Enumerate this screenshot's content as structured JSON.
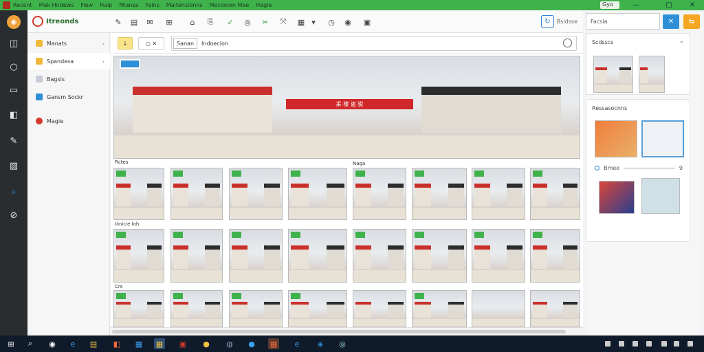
{
  "titlebar": {
    "menu": [
      "Recent",
      "Mak Hndews",
      "Fiew",
      "Halp",
      "Mianes",
      "Fains",
      "Maitensionns",
      "Mecionen Mae",
      "Hagle"
    ],
    "title": "Gyo",
    "controls": [
      "—",
      "□",
      "✕"
    ]
  },
  "app": {
    "brand": "Itreonds"
  },
  "header": {
    "tools": [
      "✎",
      "▤",
      "✉",
      "⊞",
      "⌂",
      "⎘",
      "✓",
      "◎",
      "✂",
      "⤧",
      "▦",
      "▾",
      "◷",
      "◉",
      "▣"
    ],
    "refresh_icon": "↻",
    "right_label": "Bsidsse"
  },
  "right_header": {
    "placeholder": "Facsia",
    "blue_btn": "✕",
    "orange_btn": "⇆"
  },
  "nav": {
    "items": [
      {
        "label": "Manats",
        "color": "#f0b93a",
        "chevron": "›"
      },
      {
        "label": "Spandesa",
        "color": "#f0b93a",
        "chevron": "›"
      },
      {
        "label": "Bagsls",
        "color": "#c5ccd6",
        "chevron": ""
      },
      {
        "label": "Gansm Sockr",
        "color": "#2d8fd5",
        "chevron": ""
      },
      {
        "label": "Magie",
        "color": "#d53a2b",
        "chevron": ""
      }
    ]
  },
  "search": {
    "chip1": "↓",
    "chip2": "○ ✕",
    "pill": "Sanan",
    "query": "Indoecion"
  },
  "hero": {
    "banner": "采 楼 盗 锐"
  },
  "labels": {
    "row1": "Rctes",
    "row1_right": "Naga",
    "row2": "Iiinicie  loh",
    "row3": "Crs"
  },
  "right_panel": {
    "card1_title": "Scdsscs",
    "card1_chevron": "⌄",
    "card2_title": "Ressasocnns",
    "slider_label": "Bmee",
    "slider_value": "9"
  },
  "taskbar": {
    "icons": [
      "⊞",
      "⌕",
      "◉",
      "e",
      "▤",
      "◧",
      "▦",
      "▦",
      "▣",
      "●",
      "◍",
      "●",
      "▦",
      "e",
      "◈",
      "◎"
    ]
  }
}
